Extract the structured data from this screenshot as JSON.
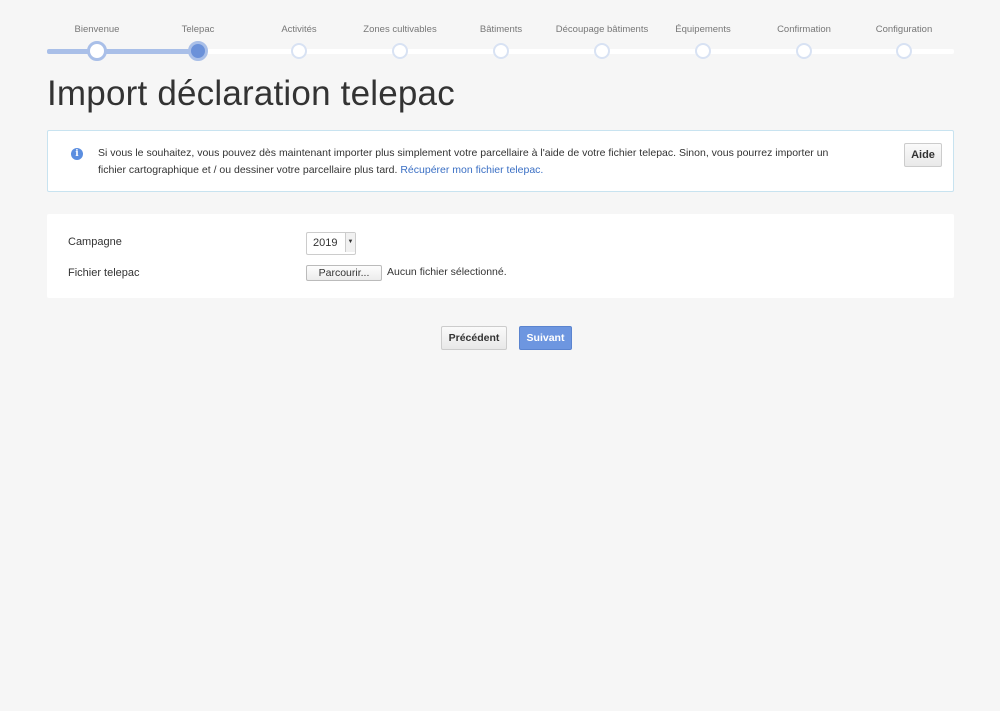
{
  "steps": [
    {
      "label": "Bienvenue",
      "state": "done"
    },
    {
      "label": "Telepac",
      "state": "current"
    },
    {
      "label": "Activités",
      "state": "todo"
    },
    {
      "label": "Zones cultivables",
      "state": "todo"
    },
    {
      "label": "Bâtiments",
      "state": "todo"
    },
    {
      "label": "Découpage bâtiments",
      "state": "todo"
    },
    {
      "label": "Équipements",
      "state": "todo"
    },
    {
      "label": "Confirmation",
      "state": "todo"
    },
    {
      "label": "Configuration",
      "state": "todo"
    }
  ],
  "page": {
    "title": "Import déclaration telepac"
  },
  "info": {
    "icon": "info-icon",
    "text": "Si vous le souhaitez, vous pouvez dès maintenant importer plus simplement votre parcellaire à l'aide de votre fichier telepac. Sinon, vous pourrez importer un fichier cartographique et / ou dessiner votre parcellaire plus tard.",
    "link": "Récupérer mon fichier telepac.",
    "help_label": "Aide"
  },
  "form": {
    "campaign_label": "Campagne",
    "campaign_value": "2019",
    "file_label": "Fichier telepac",
    "browse_label": "Parcourir...",
    "file_status": "Aucun fichier sélectionné."
  },
  "actions": {
    "prev_label": "Précédent",
    "next_label": "Suivant"
  },
  "colors": {
    "accent": "#6d96e0",
    "link": "#3a6fc4",
    "step_done": "#a9bfe8"
  }
}
